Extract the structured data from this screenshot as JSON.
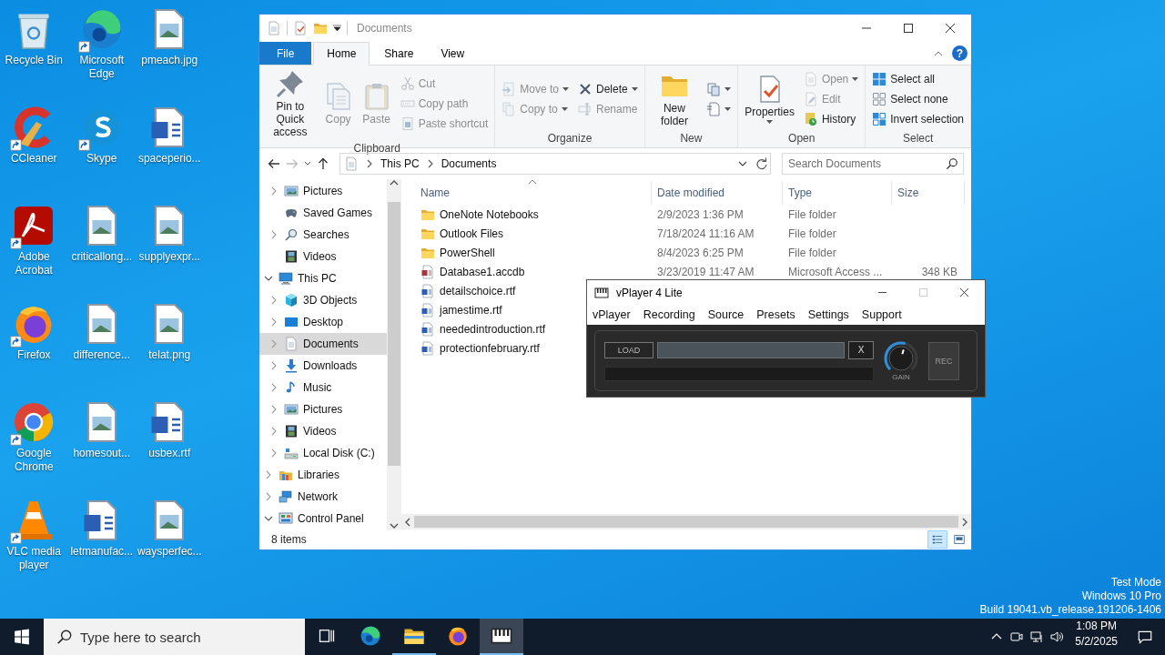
{
  "desktop": {
    "icons": [
      {
        "label": "Recycle Bin",
        "kind": "recycle",
        "shortcut": false
      },
      {
        "label": "CCleaner",
        "kind": "ccleaner",
        "shortcut": true
      },
      {
        "label": "Adobe Acrobat",
        "kind": "acrobat",
        "shortcut": true
      },
      {
        "label": "Firefox",
        "kind": "firefox",
        "shortcut": true
      },
      {
        "label": "Google Chrome",
        "kind": "chrome",
        "shortcut": true
      },
      {
        "label": "VLC media player",
        "kind": "vlc",
        "shortcut": true
      },
      {
        "label": "Microsoft Edge",
        "kind": "edge",
        "shortcut": true
      },
      {
        "label": "Skype",
        "kind": "skype",
        "shortcut": true
      },
      {
        "label": "criticallong...",
        "kind": "image",
        "shortcut": false
      },
      {
        "label": "difference...",
        "kind": "image",
        "shortcut": false
      },
      {
        "label": "homesout...",
        "kind": "image",
        "shortcut": false
      },
      {
        "label": "letmanufac...",
        "kind": "word",
        "shortcut": false
      },
      {
        "label": "pmeach.jpg",
        "kind": "image",
        "shortcut": false
      },
      {
        "label": "spaceperio...",
        "kind": "word",
        "shortcut": false
      },
      {
        "label": "supplyexpr...",
        "kind": "image",
        "shortcut": false
      },
      {
        "label": "telat.png",
        "kind": "image",
        "shortcut": false
      },
      {
        "label": "usbex.rtf",
        "kind": "word",
        "shortcut": false
      },
      {
        "label": "waysperfec...",
        "kind": "image",
        "shortcut": false
      }
    ],
    "system_info": [
      "Test Mode",
      "Windows 10 Pro",
      "Build 19041.vb_release.191206-1406"
    ]
  },
  "explorer": {
    "title": "Documents",
    "ribbon_tabs": [
      {
        "label": "File",
        "kind": "menu",
        "selected": false
      },
      {
        "label": "Home",
        "kind": "tab",
        "selected": true
      },
      {
        "label": "Share",
        "kind": "tab",
        "selected": false
      },
      {
        "label": "View",
        "kind": "tab",
        "selected": false
      }
    ],
    "help_button": "?",
    "ribbon_groups": [
      {
        "label": "Clipboard",
        "columns": [
          {
            "kind": "large",
            "buttons": [
              {
                "label": "Pin to Quick access",
                "kind": "pin",
                "disabled": false,
                "dropdown": false
              }
            ]
          },
          {
            "kind": "large",
            "buttons": [
              {
                "label": "Copy",
                "kind": "copy",
                "disabled": true,
                "dropdown": false
              }
            ]
          },
          {
            "kind": "large",
            "buttons": [
              {
                "label": "Paste",
                "kind": "paste",
                "disabled": true,
                "dropdown": false
              }
            ]
          },
          {
            "kind": "small",
            "buttons": [
              {
                "label": "Cut",
                "kind": "cut",
                "disabled": true,
                "dropdown": false
              },
              {
                "label": "Copy path",
                "kind": "copypath",
                "disabled": true,
                "dropdown": false
              },
              {
                "label": "Paste shortcut",
                "kind": "pasteshortcut",
                "disabled": true,
                "dropdown": false
              }
            ]
          }
        ]
      },
      {
        "label": "Organize",
        "columns": [
          {
            "kind": "small",
            "buttons": [
              {
                "label": "Move to",
                "kind": "moveto",
                "disabled": true,
                "dropdown": true
              },
              {
                "label": "Copy to",
                "kind": "copyto",
                "disabled": true,
                "dropdown": true
              }
            ]
          },
          {
            "kind": "small",
            "buttons": [
              {
                "label": "Delete",
                "kind": "delete",
                "disabled": false,
                "dropdown": true
              },
              {
                "label": "Rename",
                "kind": "rename",
                "disabled": true,
                "dropdown": false
              }
            ]
          }
        ]
      },
      {
        "label": "New",
        "columns": [
          {
            "kind": "large",
            "buttons": [
              {
                "label": "New folder",
                "kind": "folder",
                "disabled": false,
                "dropdown": false
              }
            ]
          },
          {
            "kind": "small",
            "buttons": [
              {
                "kind": "newitem",
                "disabled": false,
                "dropdown": true
              },
              {
                "kind": "easyaccess",
                "disabled": false,
                "dropdown": true
              }
            ]
          }
        ]
      },
      {
        "label": "Open",
        "columns": [
          {
            "kind": "large",
            "buttons": [
              {
                "label": "Properties",
                "kind": "properties",
                "disabled": false,
                "dropdown": true
              }
            ]
          },
          {
            "kind": "small",
            "buttons": [
              {
                "label": "Open",
                "kind": "open",
                "disabled": true,
                "dropdown": true
              },
              {
                "label": "Edit",
                "kind": "edit",
                "disabled": true,
                "dropdown": false
              },
              {
                "label": "History",
                "kind": "history",
                "disabled": false,
                "dropdown": false
              }
            ]
          }
        ]
      },
      {
        "label": "Select",
        "columns": [
          {
            "kind": "small",
            "buttons": [
              {
                "label": "Select all",
                "kind": "selectall",
                "disabled": false,
                "dropdown": false
              },
              {
                "label": "Select none",
                "kind": "selectnone",
                "disabled": false,
                "dropdown": false
              },
              {
                "label": "Invert selection",
                "kind": "invert",
                "disabled": false,
                "dropdown": false
              }
            ]
          }
        ]
      }
    ],
    "address": [
      "This PC",
      "Documents"
    ],
    "search": {
      "placeholder": "Search Documents"
    },
    "nav_tree": [
      {
        "children": [
          {
            "label": "Pictures",
            "kind": "pictures",
            "expanded": false,
            "selected": false
          },
          {
            "label": "Saved Games",
            "kind": "games",
            "selected": false
          },
          {
            "label": "Searches",
            "kind": "search",
            "expanded": false,
            "selected": false
          },
          {
            "label": "Videos",
            "kind": "videos",
            "selected": false
          }
        ]
      },
      {
        "label": "This PC",
        "kind": "pc",
        "expanded": true,
        "selected": false,
        "children": [
          {
            "label": "3D Objects",
            "kind": "objects",
            "expanded": false,
            "selected": false
          },
          {
            "label": "Desktop",
            "kind": "desktop",
            "expanded": false,
            "selected": false
          },
          {
            "label": "Documents",
            "kind": "documents",
            "expanded": false,
            "selected": true
          },
          {
            "label": "Downloads",
            "kind": "downloads",
            "expanded": false,
            "selected": false
          },
          {
            "label": "Music",
            "kind": "music",
            "expanded": false,
            "selected": false
          },
          {
            "label": "Pictures",
            "kind": "pictures",
            "expanded": false,
            "selected": false
          },
          {
            "label": "Videos",
            "kind": "videos",
            "expanded": false,
            "selected": false
          },
          {
            "label": "Local Disk (C:)",
            "kind": "disk",
            "expanded": false,
            "selected": false
          }
        ]
      },
      {
        "label": "Libraries",
        "kind": "libraries",
        "expanded": false,
        "selected": false
      },
      {
        "label": "Network",
        "kind": "network",
        "expanded": false,
        "selected": false
      },
      {
        "label": "Control Panel",
        "kind": "control",
        "expanded": true,
        "selected": false
      }
    ],
    "columns": [
      "Name",
      "Date modified",
      "Type",
      "Size"
    ],
    "files": [
      {
        "name": "OneNote Notebooks",
        "kind": "folder",
        "date": "2/9/2023 1:36 PM",
        "type": "File folder"
      },
      {
        "name": "Outlook Files",
        "kind": "folder",
        "date": "7/18/2024 11:16 AM",
        "type": "File folder"
      },
      {
        "name": "PowerShell",
        "kind": "folder",
        "date": "8/4/2023 6:25 PM",
        "type": "File folder"
      },
      {
        "name": "Database1.accdb",
        "kind": "access",
        "date": "3/23/2019 11:47 AM",
        "type": "Microsoft Access ...",
        "size": "348 KB"
      },
      {
        "name": "detailschoice.rtf",
        "kind": "word"
      },
      {
        "name": "jamestime.rtf",
        "kind": "word"
      },
      {
        "name": "neededintroduction.rtf",
        "kind": "word"
      },
      {
        "name": "protectionfebruary.rtf",
        "kind": "word"
      }
    ],
    "status": "8 items",
    "view_buttons": [
      {
        "kind": "details",
        "selected": true
      },
      {
        "kind": "tiles",
        "selected": false
      }
    ]
  },
  "vplayer": {
    "title": "vPlayer 4 Lite",
    "menu": [
      "vPlayer",
      "Recording",
      "Source",
      "Presets",
      "Settings",
      "Support"
    ],
    "load_button": "LOAD",
    "clear_button": "X",
    "gain": {
      "label": "GAIN",
      "level": 0.56
    },
    "rec_button": "REC"
  },
  "taskbar": {
    "search": {
      "placeholder": "Type here to search"
    },
    "apps": [
      {
        "kind": "edge",
        "running": false,
        "selected": false
      },
      {
        "kind": "explorer",
        "running": true,
        "selected": false
      },
      {
        "kind": "firefox",
        "running": false,
        "selected": false
      },
      {
        "kind": "piano",
        "running": true,
        "selected": true
      }
    ],
    "time": "1:08 PM",
    "date": "5/2/2025"
  }
}
